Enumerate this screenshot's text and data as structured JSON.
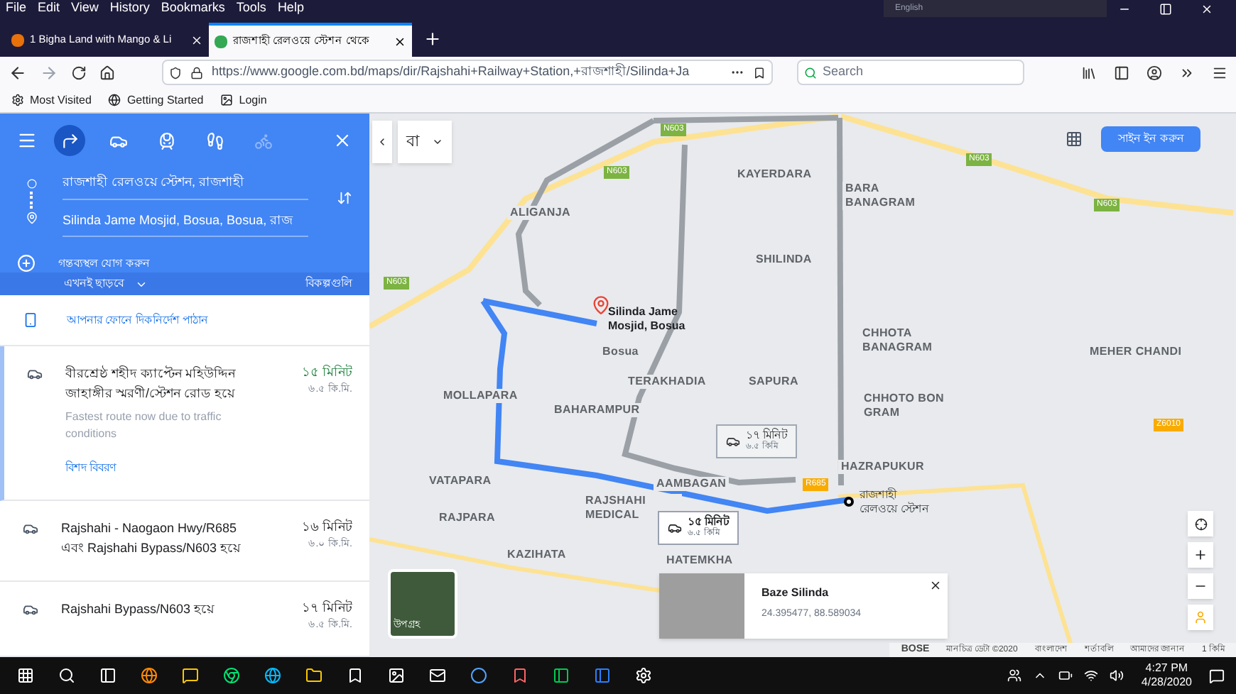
{
  "menu_bar": [
    "File",
    "Edit",
    "View",
    "History",
    "Bookmarks",
    "Tools",
    "Help"
  ],
  "language_widget": "English",
  "tabs": [
    {
      "label": "1 Bigha Land with Mango & Li",
      "selected": false
    },
    {
      "label": "রাজশাহী রেলওয়ে স্টেশন থেকে",
      "selected": true
    }
  ],
  "address_bar": {
    "url": "https://www.google.com.bd/maps/dir/Rajshahi+Railway+Station,+রাজশাহী/Silinda+Ja"
  },
  "search": {
    "placeholder": "Search"
  },
  "bookmarks": [
    "Most Visited",
    "Getting Started",
    "Login"
  ],
  "sidebar": {
    "modes": [
      {
        "kind": "best",
        "selected": true,
        "disabled": false
      },
      {
        "kind": "car",
        "selected": false,
        "disabled": false
      },
      {
        "kind": "transit",
        "selected": false,
        "disabled": false
      },
      {
        "kind": "walk",
        "selected": false,
        "disabled": false
      },
      {
        "kind": "bike",
        "selected": false,
        "disabled": true
      }
    ],
    "origin": "রাজশাহী রেলওয়ে স্টেশন, রাজশাহী",
    "destination": "Silinda Jame Mosjid, Bosua, Bosua, রাজ",
    "add_destination": "গন্তব্যস্থল যোগ করুন",
    "depart": "এখনই ছাড়বে",
    "options": "বিকল্পগুলি",
    "send_to_phone": "আপনার ফোনে দিকনির্দেশ পাঠান",
    "routes": [
      {
        "name": "বীরশ্রেষ্ঠ শহীদ ক্যাপ্টেন মহিউদ্দিন জাহাঙ্গীর স্মরণী/স্টেশন রোড হয়ে",
        "time": "১৫ মিনিট",
        "distance": "৬.৫ কি.মি.",
        "note": "Fastest route now due to traffic conditions",
        "details": "বিশদ বিবরণ",
        "selected": true
      },
      {
        "name": "Rajshahi - Naogaon Hwy/R685 এবং Rajshahi Bypass/N603 হয়ে",
        "time": "১৬ মিনিট",
        "distance": "৬.০ কি.মি.",
        "selected": false
      },
      {
        "name": "Rajshahi Bypass/N603 হয়ে",
        "time": "১৭ মিনিট",
        "distance": "৬.৫ কি.মি.",
        "selected": false
      }
    ]
  },
  "map": {
    "layer_label": "বা",
    "sign_in": "সাইন ইন করুন",
    "places": [
      "ALIGANJA",
      "KAYERDARA",
      "BARA BANAGRAM",
      "SHILINDA",
      "CHHOTA BANAGRAM",
      "Bosua",
      "TERAKHADIA",
      "SAPURA",
      "MEHER CHANDI",
      "MOLLAPARA",
      "BAHARAMPUR",
      "CHHOTO BON GRAM",
      "HAZRAPUKUR",
      "VATAPARA",
      "AAMBAGAN",
      "RAJPARA",
      "RAJSHAHI MEDICAL",
      "KAZIHATA",
      "HATEMKHA"
    ],
    "shields": [
      "N603",
      "N603",
      "N603",
      "N603",
      "N603",
      "R685",
      "Z6010"
    ],
    "destination_label": "Silinda Jame Mosjid, Bosua",
    "origin_label": "রাজশাহী রেলওয়ে স্টেশন",
    "route_bubbles": [
      {
        "time": "১৭ মিনিট",
        "distance": "৬.৫ কিমি",
        "selected": false
      },
      {
        "time": "১৫ মিনিট",
        "distance": "৬.৫ কিমি",
        "selected": true
      }
    ],
    "satellite_label": "উপগ্রহ",
    "info_card": {
      "title": "Baze Silinda",
      "coords": "24.395477, 88.589034"
    },
    "attribution": [
      "BOSE",
      "মানচিত্র ডেটা ©2020",
      "বাংলাদেশ",
      "শর্তাবলি",
      "আমাদের জানান",
      "1 কিমি"
    ]
  },
  "taskbar": {
    "time": "4:27 PM",
    "date": "4/28/2020"
  }
}
